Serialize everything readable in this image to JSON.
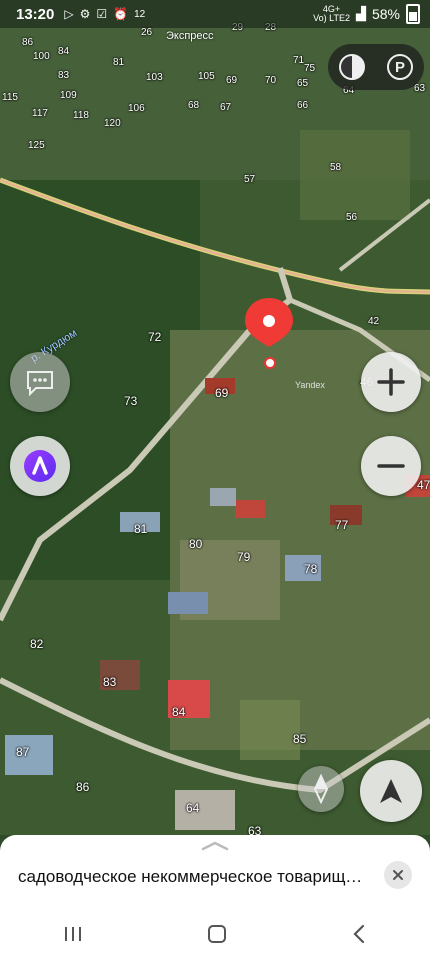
{
  "status_bar": {
    "time": "13:20",
    "left_icons": [
      "play-icon",
      "gear-icon",
      "check-box-icon",
      "alarm-icon"
    ],
    "left_number": "12",
    "network_top": "4G+",
    "network_bottom": "Vo) LTE2",
    "battery": "58%"
  },
  "map": {
    "road_name": "Экспресс",
    "river_name": "р. Курдюм",
    "watermark": "Yandex",
    "house_numbers": [
      "26",
      "29",
      "28",
      "86",
      "84",
      "100",
      "81",
      "83",
      "103",
      "105",
      "69",
      "70",
      "71",
      "75",
      "65",
      "64",
      "63",
      "115",
      "109",
      "117",
      "118",
      "106",
      "68",
      "67",
      "66",
      "120",
      "125",
      "58",
      "57",
      "56",
      "42",
      "72",
      "46",
      "69",
      "73",
      "47",
      "81",
      "80",
      "79",
      "77",
      "78",
      "82",
      "83",
      "84",
      "85",
      "87",
      "86",
      "64",
      "63"
    ]
  },
  "controls": {
    "layers_icon": "layers-icon",
    "parking_icon": "parking-icon",
    "zoom_in_icon": "plus-icon",
    "zoom_out_icon": "minus-icon",
    "chat_icon": "chat-icon",
    "alice_icon": "alice-assistant-icon",
    "compass_icon": "compass-icon",
    "location_icon": "navigation-arrow-icon"
  },
  "sheet": {
    "title": "садоводческое некоммерческое товарищество"
  },
  "navbar": {
    "recent_icon": "recent-apps-icon",
    "home_icon": "home-icon",
    "back_icon": "back-icon"
  }
}
